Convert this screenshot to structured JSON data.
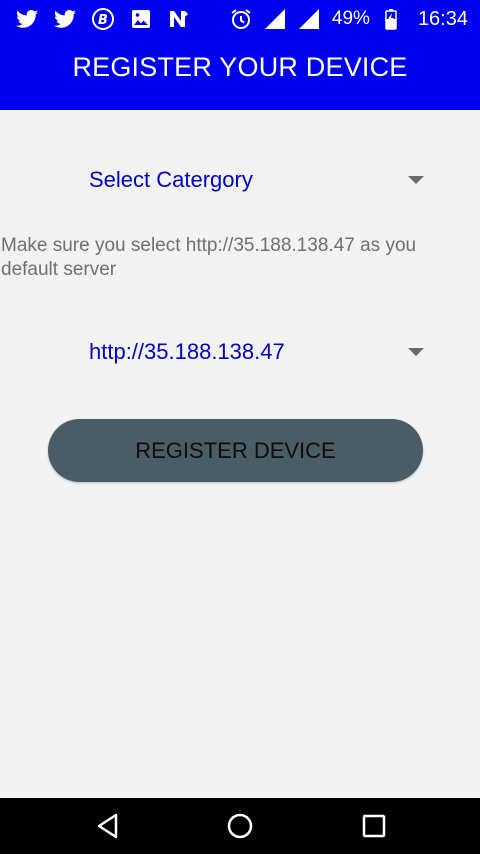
{
  "status_bar": {
    "battery_percent": "49%",
    "time": "16:34",
    "left_icons": [
      "twitter-icon",
      "twitter-icon",
      "bitcoin-icon",
      "image-icon",
      "n-app-icon"
    ],
    "right_icons": [
      "alarm-icon",
      "signal-icon",
      "signal-icon",
      "battery-charging-icon"
    ]
  },
  "app_bar": {
    "title": "REGISTER YOUR DEVICE",
    "background": "#0000f0"
  },
  "category_spinner": {
    "selected": "Select Catergory"
  },
  "helper_text": "Make sure you select http://35.188.138.47 as you default server",
  "server_spinner": {
    "selected": "http://35.188.138.47"
  },
  "register_button": {
    "label": "REGISTER DEVICE",
    "background": "#4a5c66"
  },
  "nav_bar": {
    "icons": [
      "back-icon",
      "home-icon",
      "recents-icon"
    ]
  }
}
